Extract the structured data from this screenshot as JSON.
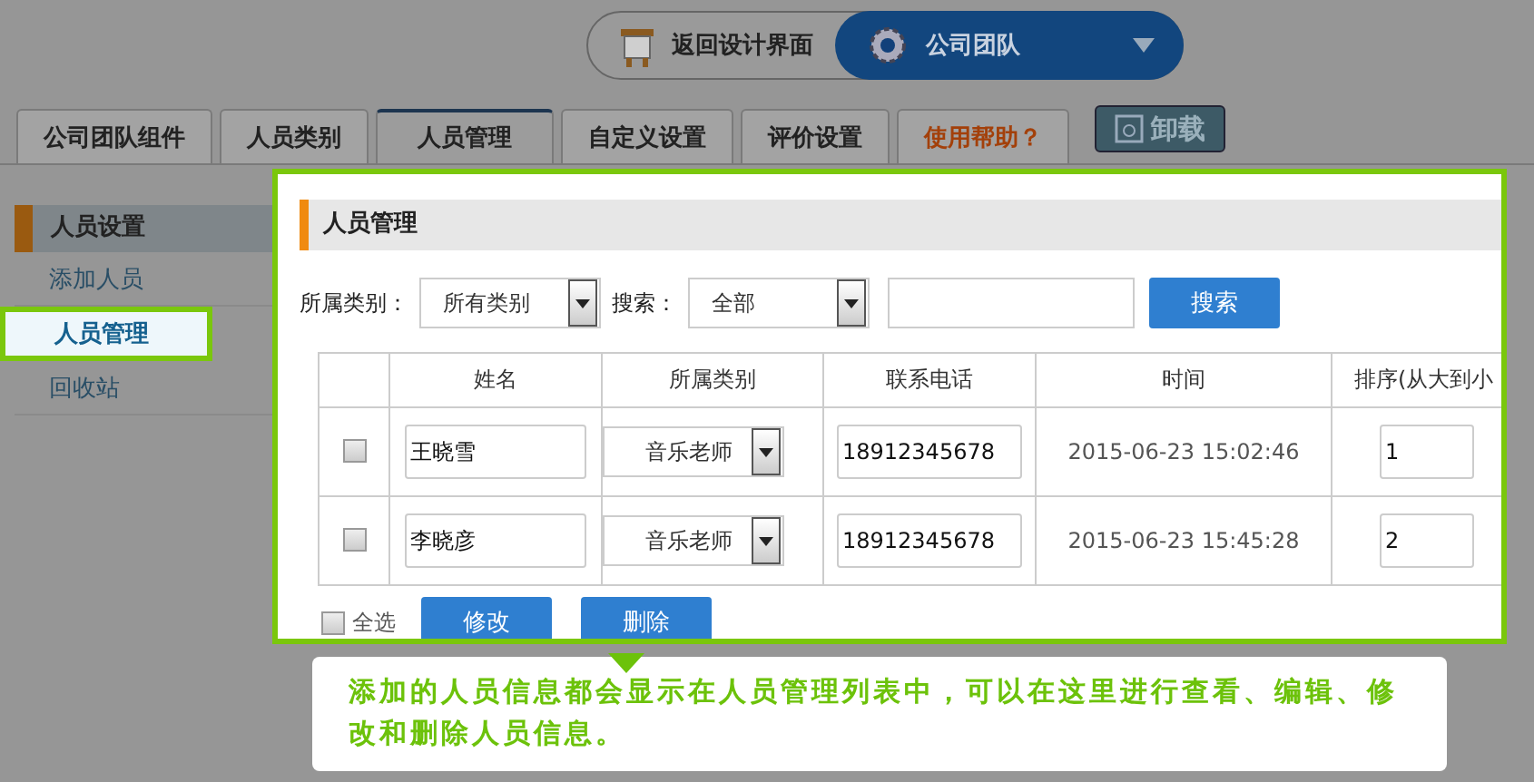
{
  "top_bar": {
    "back_button": "返回设计界面",
    "module_selector": "公司团队"
  },
  "tabs": [
    {
      "label": "公司团队组件",
      "selected": false,
      "kind": "normal"
    },
    {
      "label": "人员类别",
      "selected": false,
      "kind": "normal"
    },
    {
      "label": "人员管理",
      "selected": true,
      "kind": "normal"
    },
    {
      "label": "自定义设置",
      "selected": false,
      "kind": "normal"
    },
    {
      "label": "评价设置",
      "selected": false,
      "kind": "normal"
    },
    {
      "label": "使用帮助？",
      "selected": false,
      "kind": "help"
    }
  ],
  "uninstall_button": "卸载",
  "sidebar": {
    "heading": "人员设置",
    "items": [
      {
        "label": "添加人员",
        "selected": false
      },
      {
        "label": "人员管理",
        "selected": true
      },
      {
        "label": "回收站",
        "selected": false
      }
    ]
  },
  "panel": {
    "title": "人员管理",
    "filter": {
      "category_label": "所属类别：",
      "category_value": "所有类别",
      "search_label": "搜索：",
      "search_scope": "全部",
      "search_button": "搜索"
    },
    "table": {
      "columns": [
        "姓名",
        "所属类别",
        "联系电话",
        "时间",
        "排序(从大到小"
      ],
      "rows": [
        {
          "checked": false,
          "name": "王晓雪",
          "category": "音乐老师",
          "phone": "18912345678",
          "time": "2015-06-23 15:02:46",
          "order": "1"
        },
        {
          "checked": false,
          "name": "李晓彦",
          "category": "音乐老师",
          "phone": "18912345678",
          "time": "2015-06-23 15:45:28",
          "order": "2"
        }
      ]
    },
    "select_all": {
      "label": "全选",
      "checked": false
    },
    "buttons": [
      "修改",
      "删除"
    ]
  },
  "tooltip": "添加的人员信息都会显示在人员管理列表中，可以在这里进行查看、编辑、修改和删除人员信息。"
}
